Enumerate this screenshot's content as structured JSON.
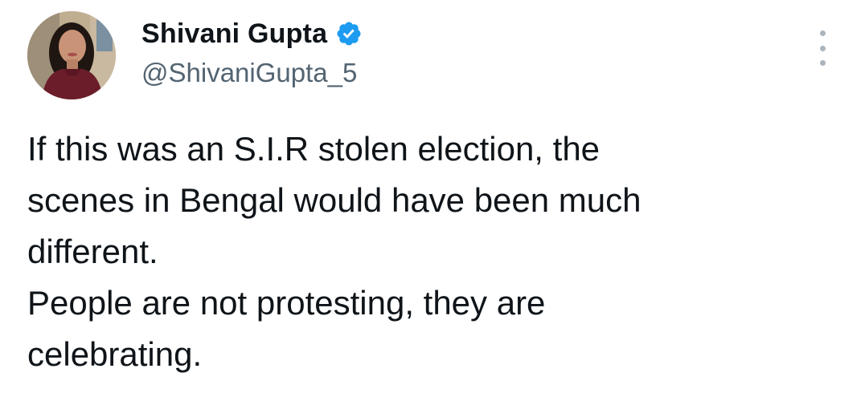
{
  "tweet": {
    "author": {
      "display_name": "Shivani Gupta",
      "handle": "@ShivaniGupta_5",
      "verified": true,
      "avatar_icon": "profile-photo"
    },
    "more_icon": "more-options-icon",
    "paragraphs": [
      "If this was an S.I.R stolen election, the\nscenes in Bengal would have been much\ndifferent.",
      "People are not protesting, they are\ncelebrating."
    ]
  },
  "colors": {
    "text": "#0f1419",
    "handle": "#536471",
    "verified_badge": "#1d9bf0",
    "more_dots": "#aab4bd"
  }
}
